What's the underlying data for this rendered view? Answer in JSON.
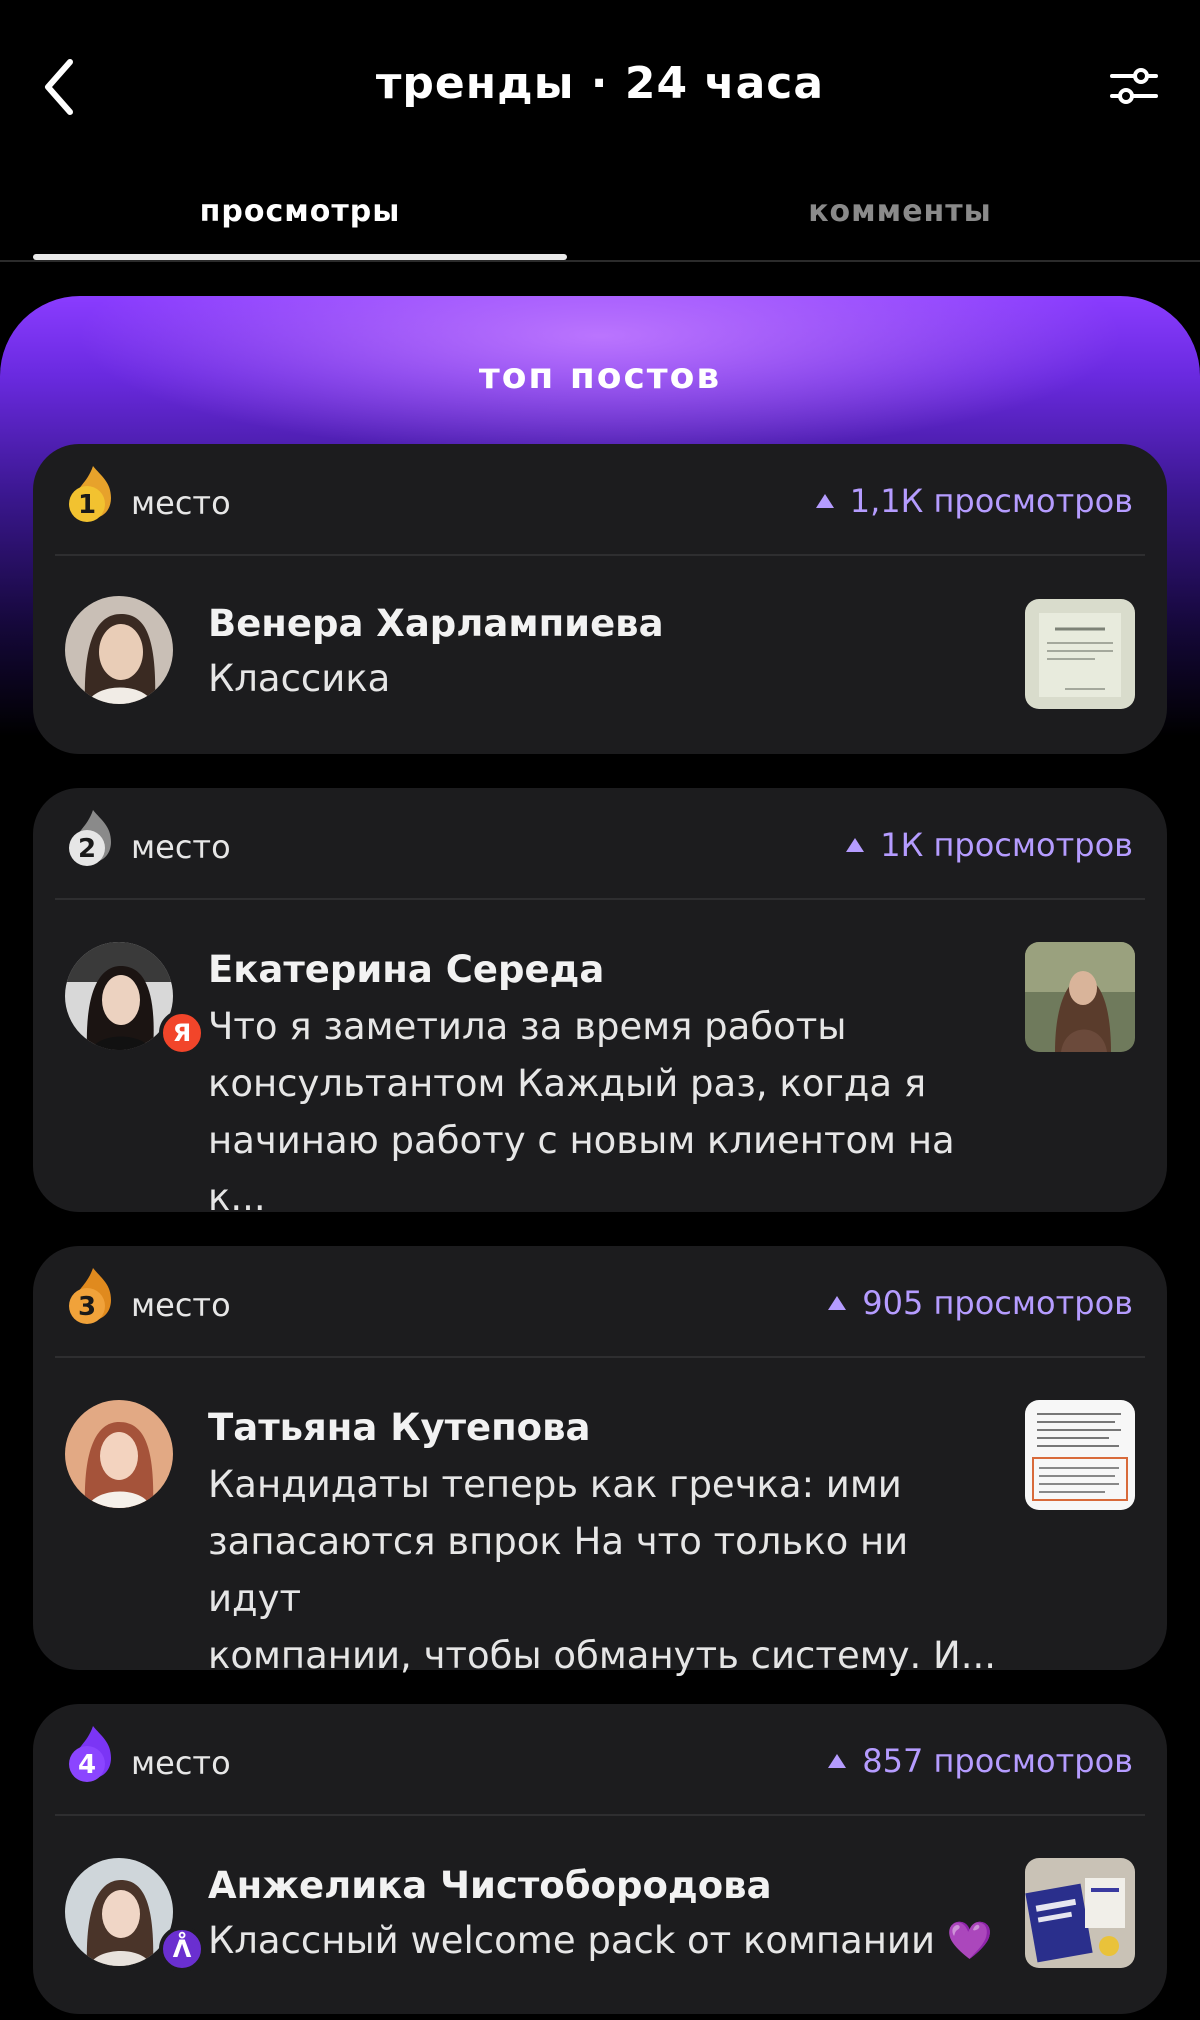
{
  "header": {
    "title": "тренды · 24 часа"
  },
  "tabs": [
    {
      "label": "просмотры",
      "active": true
    },
    {
      "label": "комменты",
      "active": false
    }
  ],
  "hero": {
    "title": "топ постов"
  },
  "colors": {
    "accent": "#b59cff",
    "purple": "#7b35f5",
    "card": "#1c1c1e"
  },
  "posts": [
    {
      "place_number": "1",
      "place_label": "место",
      "views": "1,1К просмотров",
      "author": "Венера Харлампиева",
      "text_lines": [
        "Классика"
      ],
      "badge_icon": "gold-flame-icon"
    },
    {
      "place_number": "2",
      "place_label": "место",
      "views": "1К просмотров",
      "author": "Екатерина Середа",
      "text_lines": [
        "Что я заметила за время работы",
        "консультантом Каждый раз, когда я",
        "начинаю работу с новым клиентом на к..."
      ],
      "badge_icon": "silver-flame-icon",
      "avatar_badge": "Я"
    },
    {
      "place_number": "3",
      "place_label": "место",
      "views": "905 просмотров",
      "author": "Татьяна Кутепова",
      "text_lines": [
        "Кандидаты теперь как гречка: ими",
        "запасаются впрок На что только ни идут",
        "компании, чтобы обмануть систему. И..."
      ],
      "badge_icon": "bronze-flame-icon"
    },
    {
      "place_number": "4",
      "place_label": "место",
      "views": "857 просмотров",
      "author": "Анжелика Чистобородова",
      "text_lines": [
        "Классный welcome pack от компании 💜"
      ],
      "badge_icon": "purple-flame-icon",
      "avatar_badge": "ᐰ"
    }
  ]
}
